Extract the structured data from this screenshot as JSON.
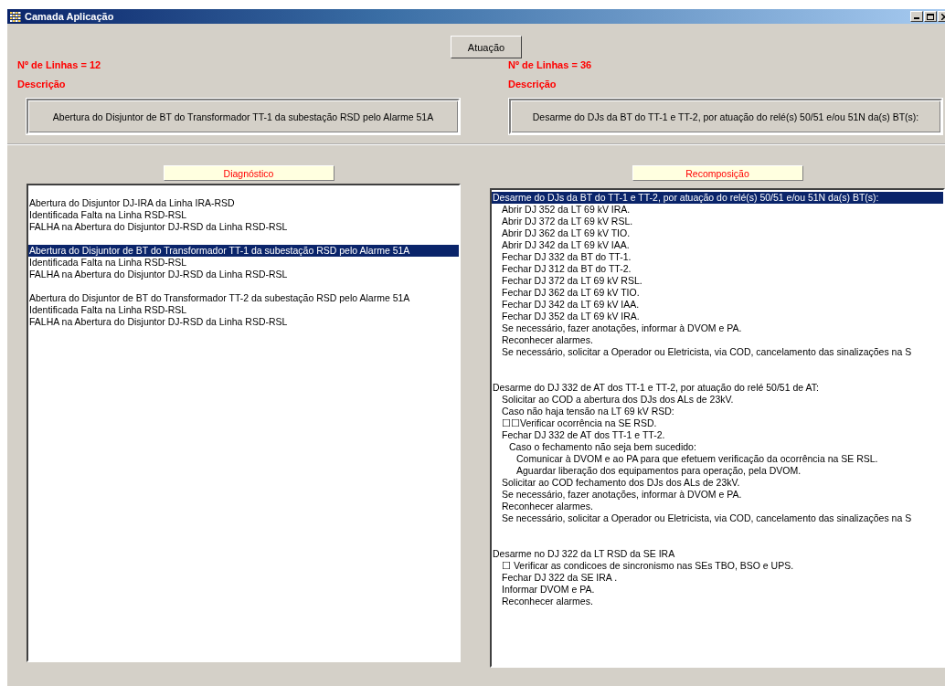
{
  "window": {
    "title": "Camada Aplicação"
  },
  "action_button": "Atuação",
  "left": {
    "count_label": "Nº de Linhas = 12",
    "description_label": "Descrição",
    "description": "Abertura do Disjuntor de BT do Transformador TT-1 da subestação RSD pelo Alarme 51A"
  },
  "right": {
    "count_label": "Nº de Linhas = 36",
    "description_label": "Descrição",
    "description": "Desarme do DJs da BT do TT-1 e TT-2, por atuação do relé(s) 50/51 e/ou 51N da(s) BT(s):"
  },
  "diagnostico": {
    "header": "Diagnóstico",
    "groups": [
      {
        "lines": [
          {
            "text": "Abertura do Disjuntor DJ-IRA da Linha IRA-RSD",
            "selected": false
          },
          {
            "text": "Identificada Falta na Linha RSD-RSL",
            "selected": false
          },
          {
            "text": "FALHA na Abertura do Disjuntor DJ-RSD da Linha RSD-RSL",
            "selected": false
          }
        ]
      },
      {
        "lines": [
          {
            "text": "Abertura do Disjuntor de BT do Transformador TT-1 da subestação RSD pelo Alarme 51A",
            "selected": true
          },
          {
            "text": "Identificada Falta na Linha RSD-RSL",
            "selected": false
          },
          {
            "text": "FALHA na Abertura do Disjuntor DJ-RSD da Linha RSD-RSL",
            "selected": false
          }
        ]
      },
      {
        "lines": [
          {
            "text": "Abertura do Disjuntor de BT do Transformador TT-2 da subestação RSD pelo Alarme 51A",
            "selected": false
          },
          {
            "text": "Identificada Falta na Linha RSD-RSL",
            "selected": false
          },
          {
            "text": "FALHA na Abertura do Disjuntor DJ-RSD da Linha RSD-RSL",
            "selected": false
          }
        ]
      }
    ]
  },
  "recomposicao": {
    "header": "Recomposição",
    "items": [
      {
        "text": "Desarme do DJs da BT do TT-1 e TT-2, por atuação do relé(s) 50/51 e/ou 51N da(s) BT(s):",
        "selected": true,
        "children": [
          {
            "text": "Abrir DJ 352 da LT 69 kV IRA.",
            "selected": false
          },
          {
            "text": "Abrir DJ 372 da LT 69 kV RSL.",
            "selected": false
          },
          {
            "text": "Abrir DJ 362 da LT 69 kV TIO.",
            "selected": false
          },
          {
            "text": "Abrir DJ 342 da LT 69 kV IAA.",
            "selected": false
          },
          {
            "text": "Fechar DJ 332 da BT do TT-1.",
            "selected": false
          },
          {
            "text": "Fechar DJ 312 da BT do TT-2.",
            "selected": false
          },
          {
            "text": "Fechar DJ 372 da LT 69 kV RSL.",
            "selected": false
          },
          {
            "text": "Fechar DJ 362 da LT 69 kV TIO.",
            "selected": false
          },
          {
            "text": "Fechar DJ 342 da LT 69 kV IAA.",
            "selected": false
          },
          {
            "text": "Fechar DJ 352 da LT 69 kV IRA.",
            "selected": false
          },
          {
            "text": "Se necessário, fazer anotações, informar à DVOM e PA.",
            "selected": false
          },
          {
            "text": "Reconhecer alarmes.",
            "selected": false
          },
          {
            "text": "Se necessário, solicitar a Operador ou Eletricista, via COD, cancelamento das sinalizações na S",
            "selected": false
          }
        ]
      },
      {
        "text": "Desarme do DJ 332 de AT dos TT-1 e TT-2, por atuação do relé 50/51 de AT:",
        "selected": false,
        "children": [
          {
            "text": "Solicitar ao COD a abertura dos DJs dos ALs de 23kV.",
            "selected": false
          },
          {
            "text": "Caso não haja tensão na LT 69 kV RSD:",
            "selected": false
          },
          {
            "text": "☐☐Verificar ocorrência na SE RSD.",
            "selected": false
          },
          {
            "text": "Fechar DJ 332 de AT dos TT-1 e TT-2.",
            "selected": false,
            "children": [
              {
                "text": "Caso o fechamento não seja bem sucedido:",
                "selected": false,
                "children": [
                  {
                    "text": "Comunicar à DVOM e ao PA para que efetuem verificação da ocorrência na SE RSL.",
                    "selected": false
                  },
                  {
                    "text": "Aguardar liberação dos equipamentos para operação, pela DVOM.",
                    "selected": false
                  }
                ]
              }
            ]
          },
          {
            "text": "Solicitar ao COD fechamento dos DJs dos ALs de 23kV.",
            "selected": false
          },
          {
            "text": "Se necessário, fazer anotações, informar à DVOM e PA.",
            "selected": false
          },
          {
            "text": "Reconhecer alarmes.",
            "selected": false
          },
          {
            "text": "Se necessário, solicitar a Operador ou Eletricista, via COD, cancelamento das sinalizações na S",
            "selected": false
          }
        ]
      },
      {
        "text": "Desarme no DJ 322 da LT RSD da SE IRA",
        "selected": false,
        "children": [
          {
            "text": "☐  Verificar as condicoes de sincronismo nas SEs TBO, BSO e UPS.",
            "selected": false
          },
          {
            "text": "Fechar DJ 322 da SE IRA .",
            "selected": false
          },
          {
            "text": "Informar DVOM e PA.",
            "selected": false
          },
          {
            "text": "Reconhecer alarmes.",
            "selected": false
          }
        ]
      }
    ]
  }
}
